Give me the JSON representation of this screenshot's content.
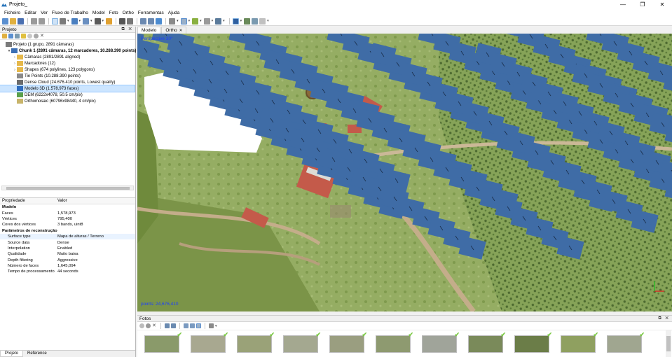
{
  "window": {
    "title": "Projeto_",
    "minimize": "—",
    "maximize": "❐",
    "close": "✕"
  },
  "menu": [
    "Ficheiro",
    "Editar",
    "Ver",
    "Fluxo de Trabalho",
    "Model",
    "Foto",
    "Ortho",
    "Ferramentas",
    "Ajuda"
  ],
  "workspace": {
    "title": "Projeto",
    "controls": "⧉ ✕",
    "tree": [
      {
        "label": "Projeto (1 grupo, 2891 câmaras)",
        "level": 0,
        "arrow": "",
        "icon": "project-icon",
        "bold": false,
        "selected": false,
        "color": "#7a7a7a"
      },
      {
        "label": "Chunk 1 (2891 câmaras, 12 marcadores, 10.288.390 points) [R]",
        "level": 1,
        "arrow": "▾",
        "icon": "chunk-icon",
        "bold": true,
        "selected": false,
        "color": "#3c6fb4"
      },
      {
        "label": "Câmaras (2891/2891 aligned)",
        "level": 2,
        "arrow": "›",
        "icon": "folder-icon",
        "bold": false,
        "selected": false,
        "color": "#e6b84a"
      },
      {
        "label": "Marcadores (12)",
        "level": 2,
        "arrow": "›",
        "icon": "folder-icon",
        "bold": false,
        "selected": false,
        "color": "#e6b84a"
      },
      {
        "label": "Shapes (674 polylines, 123 polygons)",
        "level": 2,
        "arrow": "›",
        "icon": "folder-icon",
        "bold": false,
        "selected": false,
        "color": "#e6b84a"
      },
      {
        "label": "Tie Points (10.288.390 points)",
        "level": 2,
        "arrow": "",
        "icon": "tie-points-icon",
        "bold": false,
        "selected": false,
        "color": "#8a8a8a"
      },
      {
        "label": "Dense Cloud (24.676.410 points, Lowest quality)",
        "level": 2,
        "arrow": "",
        "icon": "dense-cloud-icon",
        "bold": false,
        "selected": false,
        "color": "#6b6b6b"
      },
      {
        "label": "Modelo 3D (1.578,973 faces)",
        "level": 2,
        "arrow": "",
        "icon": "model-icon",
        "bold": false,
        "selected": true,
        "color": "#2f6dbf"
      },
      {
        "label": "DEM (6222x4078, 50.5 cm/pix)",
        "level": 2,
        "arrow": "",
        "icon": "dem-icon",
        "bold": false,
        "selected": false,
        "color": "#5aa04a"
      },
      {
        "label": "Orthomosaic (60796x98440, 4 cm/pix)",
        "level": 2,
        "arrow": "",
        "icon": "ortho-icon",
        "bold": false,
        "selected": false,
        "color": "#c8b46a"
      }
    ]
  },
  "properties": {
    "header_key": "Propriedade",
    "header_value": "Valor",
    "rows": [
      {
        "k": "Modelo",
        "v": "",
        "type": "section"
      },
      {
        "k": "Faces",
        "v": "1,578,973",
        "type": "row"
      },
      {
        "k": "Vértices",
        "v": "795,400",
        "type": "row"
      },
      {
        "k": "Cores dos vértices",
        "v": "3 bands, uint8",
        "type": "row"
      },
      {
        "k": "Parâmetros de reconstrução",
        "v": "",
        "type": "section"
      },
      {
        "k": "Surface type",
        "v": "Mapa de alturas / Terreno",
        "type": "sub-hl"
      },
      {
        "k": "Source data",
        "v": "Dense",
        "type": "sub"
      },
      {
        "k": "Interpolation",
        "v": "Enabled",
        "type": "sub"
      },
      {
        "k": "Qualidade",
        "v": "Muito baixa",
        "type": "sub"
      },
      {
        "k": "Depth filtering",
        "v": "Aggressive",
        "type": "sub"
      },
      {
        "k": "Número de faces",
        "v": "1,645,094",
        "type": "sub"
      },
      {
        "k": "Tempo de processamento",
        "v": "44 seconds",
        "type": "sub"
      }
    ]
  },
  "bottom_tabs": [
    "Projeto",
    "Reference"
  ],
  "view_tabs": [
    {
      "label": "Modelo",
      "active": true,
      "closable": false
    },
    {
      "label": "Ortho",
      "active": false,
      "closable": true
    }
  ],
  "viewport": {
    "perspective_label": "Perspective 30°",
    "points_label": "points: 24,676,410",
    "camera_color": "#3f6ca6"
  },
  "photos": {
    "title": "Fotos",
    "controls": "⧉ ✕",
    "count_visible": 11
  }
}
